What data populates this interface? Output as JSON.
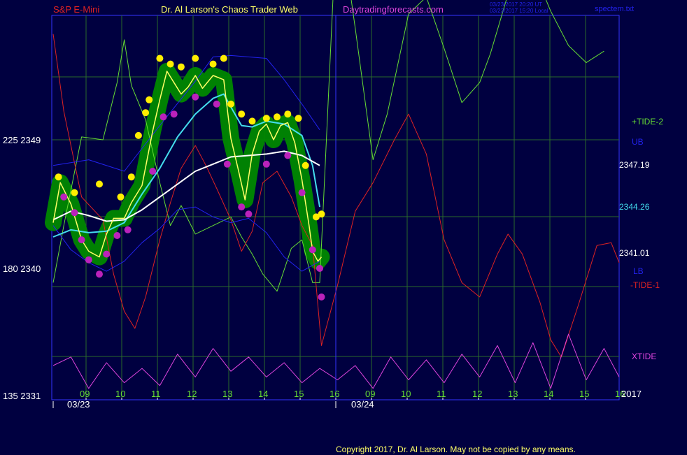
{
  "header": {
    "instrument": "S&P E-Mini",
    "source": "Dr. Al Larson's Chaos Trader Web",
    "site": "Daytradingforecasts.com",
    "stamp_ut": "03/23/2017 20:20 UT",
    "stamp_local": "03/23/2017 15:20 Local",
    "file": "spectem.txt"
  },
  "footer": {
    "copyright": "Copyright 2017, Dr. Al Larson. May not be copied by any means."
  },
  "colors": {
    "background": "#000040",
    "plot_frame": "#3333ff",
    "grid": "#2a6a2a",
    "tide_plus": "#66dd33",
    "tide_minus": "#dd2222",
    "xtide": "#dd44dd",
    "ub_lb": "#2222ee",
    "avg_fast": "#44ddee",
    "avg_slow": "#ffffff",
    "price": "#ffff66",
    "bubble": "#008800",
    "high_dot": "#ffee00",
    "low_dot": "#bb22bb"
  },
  "chart_data": {
    "type": "line",
    "y_left_labels": [
      {
        "osc": "225",
        "price": "2349"
      },
      {
        "osc": "180",
        "price": "2340"
      },
      {
        "osc": "135",
        "price": "2331"
      }
    ],
    "ylim": [
      2331,
      2349
    ],
    "x_hours": [
      "09",
      "10",
      "11",
      "12",
      "13",
      "14",
      "15",
      "16",
      "09",
      "10",
      "11",
      "12",
      "13",
      "14",
      "15",
      "16"
    ],
    "x_dates": [
      "03/23",
      "03/24"
    ],
    "x_year_label": "2017",
    "right_labels": {
      "tide_plus": "+TIDE-2",
      "ub": "UB",
      "price_ub": "2347.19",
      "price_avg": "2344.26",
      "price_low": "2341.01",
      "lb": "LB",
      "tide_minus": "-TIDE-1",
      "xtide": "XTIDE"
    },
    "series": [
      {
        "name": "+TIDE-2",
        "values": [
          [
            0.0,
            175
          ],
          [
            0.3,
            195
          ],
          [
            0.8,
            226
          ],
          [
            1.4,
            225
          ],
          [
            1.8,
            245
          ],
          [
            2.0,
            260
          ],
          [
            2.2,
            244
          ],
          [
            2.6,
            232
          ],
          [
            3.0,
            210
          ],
          [
            3.3,
            195
          ],
          [
            3.6,
            202
          ],
          [
            4.0,
            192
          ],
          [
            4.5,
            195
          ],
          [
            5.0,
            198
          ],
          [
            5.3,
            191
          ],
          [
            5.6,
            185
          ],
          [
            5.9,
            178
          ],
          [
            6.3,
            172
          ],
          [
            6.7,
            187
          ],
          [
            7.0,
            190
          ],
          [
            7.3,
            175
          ],
          [
            7.5,
            175
          ],
          [
            8.0,
            308
          ],
          [
            8.5,
            264
          ],
          [
            9.0,
            218
          ],
          [
            9.4,
            234
          ],
          [
            10.0,
            269
          ],
          [
            10.5,
            275
          ],
          [
            11.0,
            257
          ],
          [
            11.5,
            238
          ],
          [
            12.0,
            245
          ],
          [
            12.3,
            255
          ],
          [
            12.8,
            276
          ],
          [
            13.3,
            289
          ],
          [
            13.6,
            282
          ],
          [
            14.0,
            270
          ],
          [
            14.5,
            258
          ],
          [
            15.0,
            252
          ],
          [
            15.5,
            256
          ]
        ]
      },
      {
        "name": "-TIDE-1",
        "values": [
          [
            0.0,
            262
          ],
          [
            0.3,
            235
          ],
          [
            0.8,
            205
          ],
          [
            1.4,
            197
          ],
          [
            1.7,
            178
          ],
          [
            2.0,
            165
          ],
          [
            2.3,
            159
          ],
          [
            2.6,
            170
          ],
          [
            3.0,
            190
          ],
          [
            3.3,
            203
          ],
          [
            3.6,
            215
          ],
          [
            4.0,
            223
          ],
          [
            4.3,
            216
          ],
          [
            4.6,
            208
          ],
          [
            5.0,
            197
          ],
          [
            5.3,
            186
          ],
          [
            5.6,
            193
          ],
          [
            5.9,
            210
          ],
          [
            6.3,
            214
          ],
          [
            6.7,
            205
          ],
          [
            7.0,
            195
          ],
          [
            7.3,
            188
          ],
          [
            7.55,
            153
          ],
          [
            8.0,
            174
          ],
          [
            8.5,
            200
          ],
          [
            9.0,
            210
          ],
          [
            9.6,
            225
          ],
          [
            10.0,
            234
          ],
          [
            10.5,
            220
          ],
          [
            11.0,
            190
          ],
          [
            11.5,
            175
          ],
          [
            12.0,
            170
          ],
          [
            12.5,
            185
          ],
          [
            12.8,
            192
          ],
          [
            13.2,
            185
          ],
          [
            13.7,
            168
          ],
          [
            14.0,
            155
          ],
          [
            14.3,
            149
          ],
          [
            14.8,
            168
          ],
          [
            15.3,
            188
          ],
          [
            15.7,
            189
          ],
          [
            16.0,
            182
          ]
        ]
      },
      {
        "name": "XTIDE",
        "values": [
          [
            0.0,
            146
          ],
          [
            0.5,
            149
          ],
          [
            1.0,
            138
          ],
          [
            1.5,
            147
          ],
          [
            2.0,
            140
          ],
          [
            2.5,
            145
          ],
          [
            3.0,
            139
          ],
          [
            3.5,
            150
          ],
          [
            4.0,
            142
          ],
          [
            4.5,
            152
          ],
          [
            5.0,
            144
          ],
          [
            5.5,
            149
          ],
          [
            6.0,
            142
          ],
          [
            6.5,
            147
          ],
          [
            7.0,
            140
          ],
          [
            7.5,
            145
          ],
          [
            8.0,
            141
          ],
          [
            8.5,
            146
          ],
          [
            9.0,
            138
          ],
          [
            9.5,
            149
          ],
          [
            10.0,
            141
          ],
          [
            10.5,
            148
          ],
          [
            11.0,
            140
          ],
          [
            11.5,
            150
          ],
          [
            12.0,
            142
          ],
          [
            12.5,
            153
          ],
          [
            13.0,
            140
          ],
          [
            13.5,
            154
          ],
          [
            14.0,
            138
          ],
          [
            14.5,
            157
          ],
          [
            15.0,
            141
          ],
          [
            15.5,
            152
          ],
          [
            16.0,
            142
          ]
        ]
      },
      {
        "name": "UB",
        "values": [
          [
            0.0,
            2347.2
          ],
          [
            1.0,
            2347.6
          ],
          [
            2.0,
            2346.8
          ],
          [
            3.0,
            2350.0
          ],
          [
            4.0,
            2353.1
          ],
          [
            4.5,
            2354.8
          ],
          [
            5.0,
            2354.9
          ],
          [
            6.0,
            2354.7
          ],
          [
            6.5,
            2353.2
          ],
          [
            7.0,
            2351.5
          ],
          [
            7.5,
            2349.7
          ]
        ]
      },
      {
        "name": "LB",
        "values": [
          [
            0.0,
            2343.0
          ],
          [
            0.5,
            2341.3
          ],
          [
            1.0,
            2340.4
          ],
          [
            1.5,
            2339.8
          ],
          [
            2.0,
            2340.5
          ],
          [
            2.5,
            2341.8
          ],
          [
            3.0,
            2342.8
          ],
          [
            3.5,
            2344.1
          ],
          [
            4.0,
            2344.3
          ],
          [
            4.5,
            2343.6
          ],
          [
            5.0,
            2343.2
          ],
          [
            5.5,
            2343.5
          ],
          [
            6.0,
            2342.5
          ],
          [
            6.5,
            2340.8
          ],
          [
            7.0,
            2339.8
          ],
          [
            7.5,
            2340.5
          ]
        ]
      },
      {
        "name": "AVG-FAST",
        "values": [
          [
            0.0,
            2342.2
          ],
          [
            0.5,
            2342.7
          ],
          [
            1.0,
            2342.5
          ],
          [
            1.5,
            2342.6
          ],
          [
            2.0,
            2343.2
          ],
          [
            2.5,
            2345.2
          ],
          [
            3.0,
            2347.0
          ],
          [
            3.5,
            2349.2
          ],
          [
            4.0,
            2350.8
          ],
          [
            4.5,
            2351.9
          ],
          [
            4.8,
            2352.2
          ],
          [
            5.0,
            2351.3
          ],
          [
            5.3,
            2350.0
          ],
          [
            5.6,
            2349.9
          ],
          [
            6.0,
            2350.3
          ],
          [
            6.5,
            2350.1
          ],
          [
            7.0,
            2349.3
          ],
          [
            7.3,
            2347.2
          ],
          [
            7.5,
            2344.3
          ]
        ]
      },
      {
        "name": "AVG-SLOW",
        "values": [
          [
            0.0,
            2343.4
          ],
          [
            0.5,
            2344.0
          ],
          [
            1.0,
            2343.7
          ],
          [
            1.5,
            2343.3
          ],
          [
            2.0,
            2343.4
          ],
          [
            2.5,
            2344.1
          ],
          [
            3.0,
            2345.0
          ],
          [
            3.5,
            2345.9
          ],
          [
            4.0,
            2346.8
          ],
          [
            4.5,
            2347.3
          ],
          [
            5.0,
            2347.8
          ],
          [
            5.5,
            2347.9
          ],
          [
            6.0,
            2348.0
          ],
          [
            6.5,
            2348.2
          ],
          [
            7.0,
            2347.9
          ],
          [
            7.5,
            2347.2
          ]
        ]
      },
      {
        "name": "PRICE",
        "values": [
          [
            0.0,
            2343.2
          ],
          [
            0.2,
            2346.0
          ],
          [
            0.5,
            2344.5
          ],
          [
            0.8,
            2342.0
          ],
          [
            1.0,
            2341.2
          ],
          [
            1.3,
            2340.8
          ],
          [
            1.5,
            2342.4
          ],
          [
            1.7,
            2343.5
          ],
          [
            2.0,
            2343.5
          ],
          [
            2.2,
            2344.6
          ],
          [
            2.5,
            2345.8
          ],
          [
            2.8,
            2349.6
          ],
          [
            3.0,
            2351.8
          ],
          [
            3.2,
            2353.8
          ],
          [
            3.4,
            2353.0
          ],
          [
            3.6,
            2352.2
          ],
          [
            3.8,
            2352.7
          ],
          [
            4.0,
            2353.5
          ],
          [
            4.2,
            2352.6
          ],
          [
            4.5,
            2353.5
          ],
          [
            4.8,
            2353.2
          ],
          [
            5.0,
            2349.1
          ],
          [
            5.2,
            2347.0
          ],
          [
            5.4,
            2344.8
          ],
          [
            5.6,
            2348.0
          ],
          [
            5.8,
            2349.6
          ],
          [
            6.0,
            2350.1
          ],
          [
            6.2,
            2349.0
          ],
          [
            6.4,
            2350.0
          ],
          [
            6.6,
            2350.2
          ],
          [
            6.8,
            2348.8
          ],
          [
            7.0,
            2346.2
          ],
          [
            7.2,
            2343.0
          ],
          [
            7.3,
            2341.2
          ],
          [
            7.45,
            2340.5
          ],
          [
            7.55,
            2340.8
          ]
        ]
      }
    ],
    "highs": [
      [
        0.15,
        2346.4
      ],
      [
        0.6,
        2345.3
      ],
      [
        1.3,
        2345.9
      ],
      [
        1.9,
        2345.0
      ],
      [
        2.2,
        2346.4
      ],
      [
        2.4,
        2349.3
      ],
      [
        2.6,
        2350.9
      ],
      [
        2.7,
        2351.8
      ],
      [
        3.0,
        2354.7
      ],
      [
        3.3,
        2354.3
      ],
      [
        3.6,
        2354.1
      ],
      [
        4.0,
        2354.7
      ],
      [
        4.5,
        2354.3
      ],
      [
        4.8,
        2354.7
      ],
      [
        5.0,
        2351.5
      ],
      [
        5.3,
        2350.8
      ],
      [
        5.6,
        2350.3
      ],
      [
        6.0,
        2350.5
      ],
      [
        6.3,
        2350.6
      ],
      [
        6.6,
        2350.8
      ],
      [
        6.9,
        2350.5
      ],
      [
        7.1,
        2347.2
      ],
      [
        7.4,
        2343.6
      ],
      [
        7.55,
        2343.8
      ]
    ],
    "lows": [
      [
        0.3,
        2345.0
      ],
      [
        0.6,
        2343.9
      ],
      [
        0.8,
        2342.0
      ],
      [
        1.0,
        2340.6
      ],
      [
        1.3,
        2339.6
      ],
      [
        1.5,
        2341.0
      ],
      [
        1.8,
        2342.3
      ],
      [
        2.1,
        2342.7
      ],
      [
        2.8,
        2346.8
      ],
      [
        3.1,
        2350.6
      ],
      [
        3.4,
        2350.8
      ],
      [
        4.0,
        2352.0
      ],
      [
        4.6,
        2351.5
      ],
      [
        4.9,
        2347.3
      ],
      [
        5.3,
        2344.3
      ],
      [
        5.5,
        2343.8
      ],
      [
        6.0,
        2347.3
      ],
      [
        6.6,
        2347.9
      ],
      [
        7.0,
        2345.3
      ],
      [
        7.3,
        2341.3
      ],
      [
        7.5,
        2340.0
      ],
      [
        7.55,
        2338.0
      ]
    ]
  }
}
